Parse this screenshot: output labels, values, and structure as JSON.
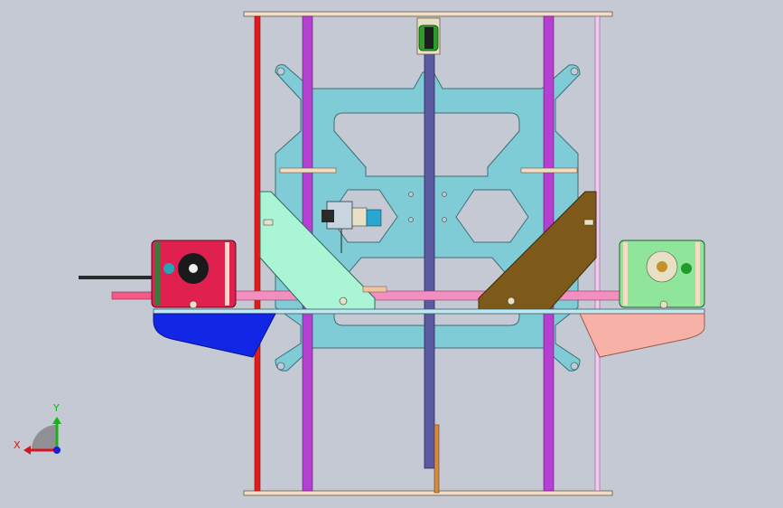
{
  "viewport": {
    "background_color": "#c5c9d3",
    "triad": {
      "x_label": "X",
      "y_label": "Y",
      "x_color": "#d8141a",
      "y_color": "#19b319",
      "z_color": "#1b1bd8"
    }
  },
  "parts": {
    "frame_top_bar": {
      "color": "#f1dcc4"
    },
    "frame_bottom_bar": {
      "color": "#f1dcc4"
    },
    "left_red_rod": {
      "color": "#e31b1b"
    },
    "purple_rods": {
      "color": "#b43fd0"
    },
    "right_thin_rod": {
      "color": "#f2c9f0"
    },
    "carriage_plate": {
      "color": "#7fcbd6"
    },
    "center_belt": {
      "color": "#5b5aa0"
    },
    "pulley": {
      "color": "#2f9b2a"
    },
    "left_bracket": {
      "color": "#a9f5d6"
    },
    "right_bracket": {
      "color": "#7d5a19"
    },
    "left_motor": {
      "color": "#e0204f"
    },
    "right_motor": {
      "color": "#8fe59a"
    },
    "left_foot": {
      "color": "#1226e6"
    },
    "right_foot": {
      "color": "#f7b1a7"
    },
    "pink_rod": {
      "color": "#f28fc0"
    },
    "horizontal_beam": {
      "color": "#bfe8f1"
    },
    "small_motor": {
      "color": "#28a6d0"
    }
  }
}
